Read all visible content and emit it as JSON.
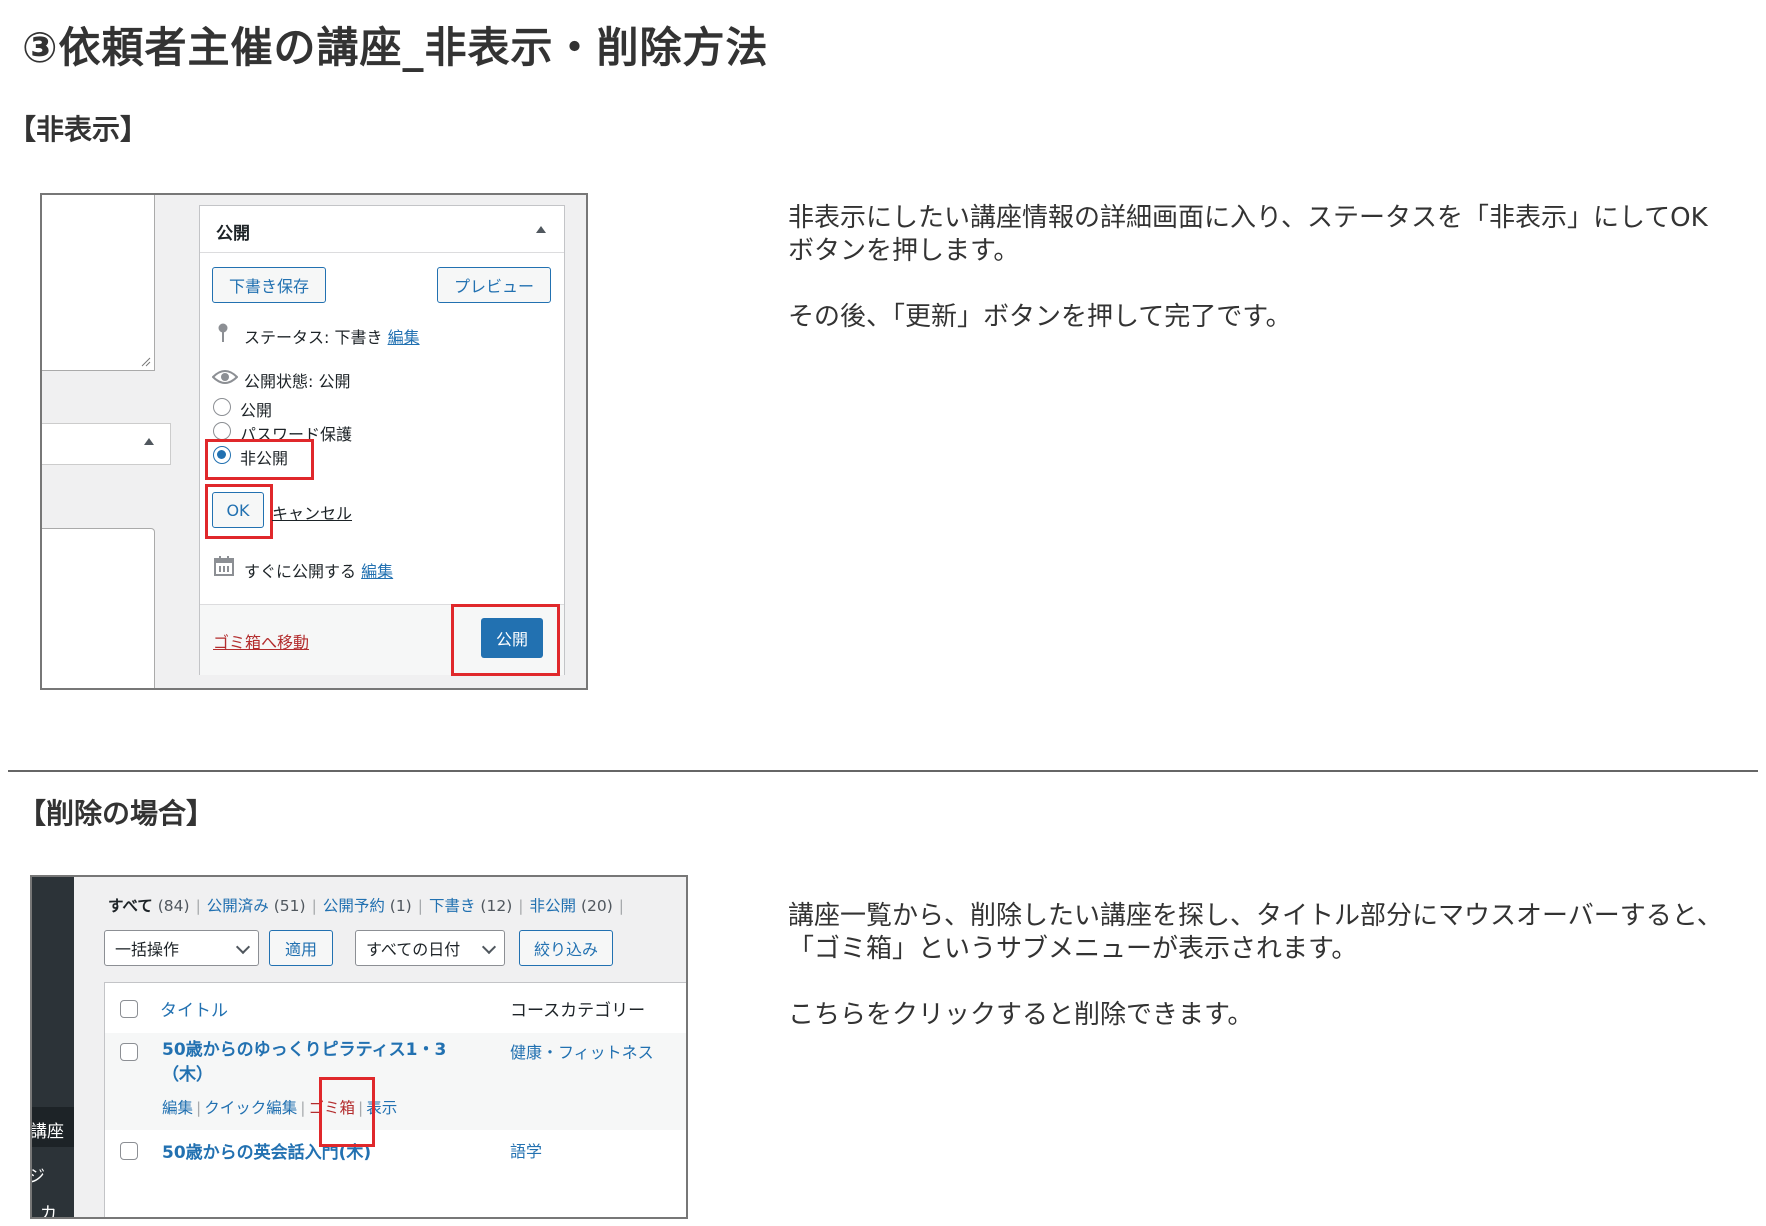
{
  "page": {
    "title": "③依頼者主催の講座_非表示・削除方法"
  },
  "hide_section": {
    "heading": "【非表示】",
    "description": [
      "非表示にしたい講座情報の詳細画面に入り、ステータスを「非表示」にしてOKボタンを押します。",
      "その後、「更新」ボタンを押して完了です。"
    ],
    "publish_box": {
      "header": "公開",
      "save_draft": "下書き保存",
      "preview": "プレビュー",
      "status_label": "ステータス: 下書き",
      "status_edit": "編集",
      "visibility_label": "公開状態: 公開",
      "options": [
        "公開",
        "パスワード保護",
        "非公開"
      ],
      "selected_option": "非公開",
      "ok": "OK",
      "cancel": "キャンセル",
      "schedule_label": "すぐに公開する",
      "schedule_edit": "編集",
      "trash": "ゴミ箱へ移動",
      "publish": "公開"
    }
  },
  "delete_section": {
    "heading": "【削除の場合】",
    "description": [
      "講座一覧から、削除したい講座を探し、タイトル部分にマウスオーバーすると、「ゴミ箱」というサブメニューが表示されます。",
      "こちらをクリックすると削除できます。"
    ],
    "list": {
      "filters": [
        {
          "label": "すべて",
          "count": "(84)"
        },
        {
          "label": "公開済み",
          "count": "(51)"
        },
        {
          "label": "公開予約",
          "count": "(1)"
        },
        {
          "label": "下書き",
          "count": "(12)"
        },
        {
          "label": "非公開",
          "count": "(20)"
        }
      ],
      "bulk_action": "一括操作",
      "apply": "適用",
      "all_dates": "すべての日付",
      "filter": "絞り込み",
      "col_title": "タイトル",
      "col_category": "コースカテゴリー",
      "sidebar_text": [
        "講座",
        "ジ",
        "カ"
      ],
      "rows": [
        {
          "title": "50歳からのゆっくりピラティス1・3（木）",
          "category": "健康・フィットネス",
          "actions": {
            "edit": "編集",
            "quick_edit": "クイック編集",
            "trash": "ゴミ箱",
            "view": "表示"
          }
        },
        {
          "title": "50歳からの英会話入門(木)",
          "category": "語学"
        }
      ]
    }
  },
  "colors": {
    "wp_blue": "#2271b1",
    "highlight_red": "#e0282b",
    "trash_red": "#b32d2e"
  }
}
